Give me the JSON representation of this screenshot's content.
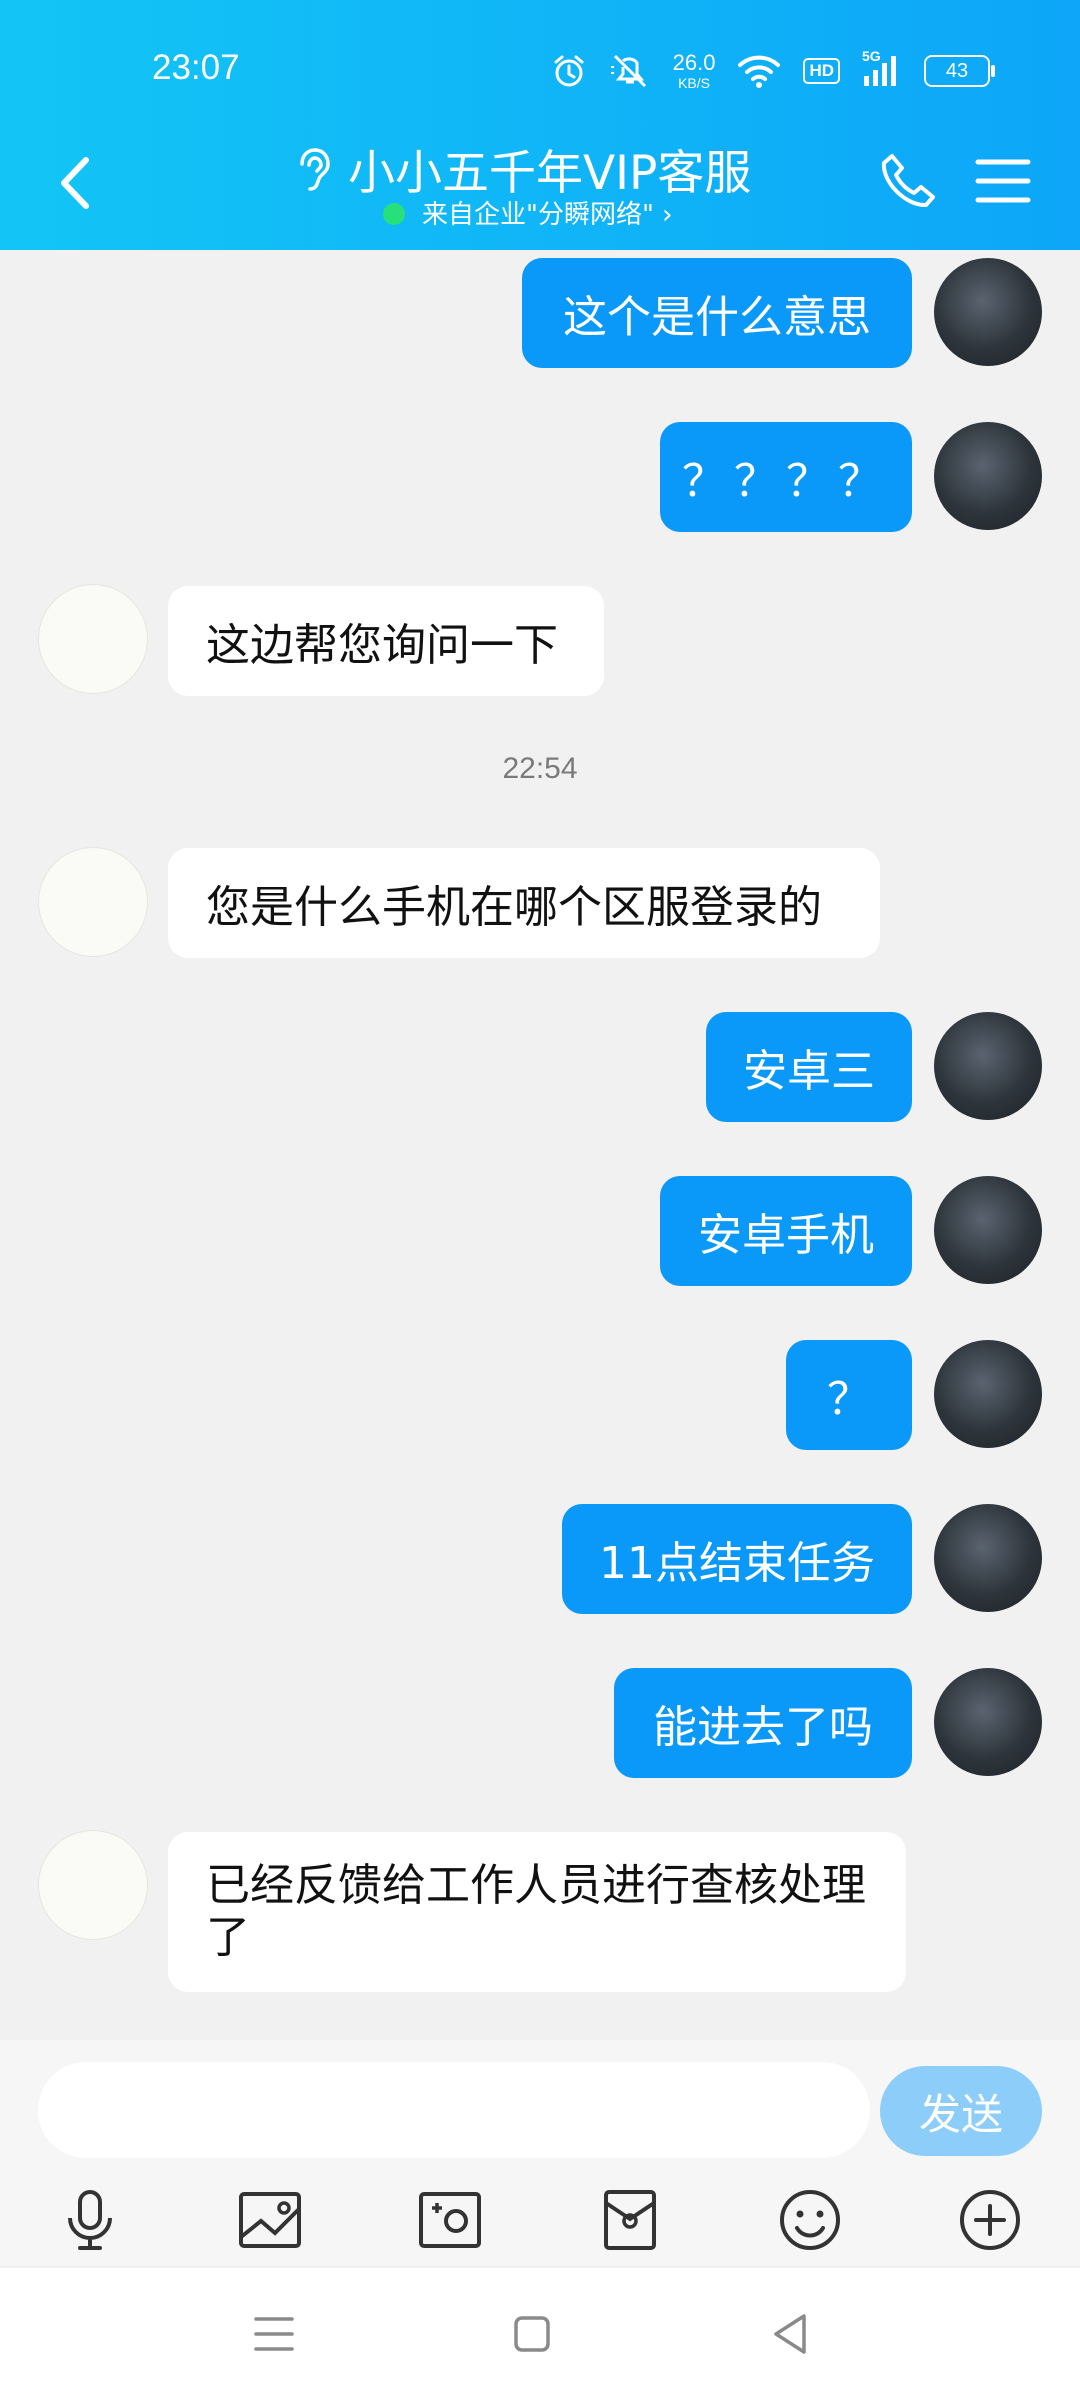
{
  "status_bar": {
    "time": "23:07",
    "net_speed_value": "26.0",
    "net_speed_unit": "KB/S",
    "hd_label": "HD",
    "network_type": "5G",
    "battery": "43"
  },
  "header": {
    "title": "小小五千年VIP客服",
    "subtitle": "来自企业\"分瞬网络\" ›"
  },
  "messages": [
    {
      "from": "me",
      "text": "这个是什么意思"
    },
    {
      "from": "me",
      "text": "？？？？"
    },
    {
      "from": "cs",
      "text": "这边帮您询问一下"
    },
    {
      "from": "cs",
      "text": "您是什么手机在哪个区服登录的"
    },
    {
      "from": "me",
      "text": "安卓三"
    },
    {
      "from": "me",
      "text": "安卓手机"
    },
    {
      "from": "me",
      "text": "？"
    },
    {
      "from": "me",
      "text": "11点结束任务"
    },
    {
      "from": "me",
      "text": "能进去了吗"
    },
    {
      "from": "cs",
      "text": "已经反馈给工作人员进行查核处理了"
    }
  ],
  "timestamp": "22:54",
  "input": {
    "value": "",
    "placeholder": "",
    "send_label": "发送"
  },
  "toolbar": [
    "mic-icon",
    "image-icon",
    "camera-icon",
    "red-packet-icon",
    "emoji-icon",
    "plus-icon"
  ],
  "colors": {
    "header_start": "#13c5f6",
    "header_end": "#0da6f8",
    "my_bubble": "#0a98f9",
    "send_button": "#8ccdfa",
    "online_dot": "#27e07a"
  }
}
